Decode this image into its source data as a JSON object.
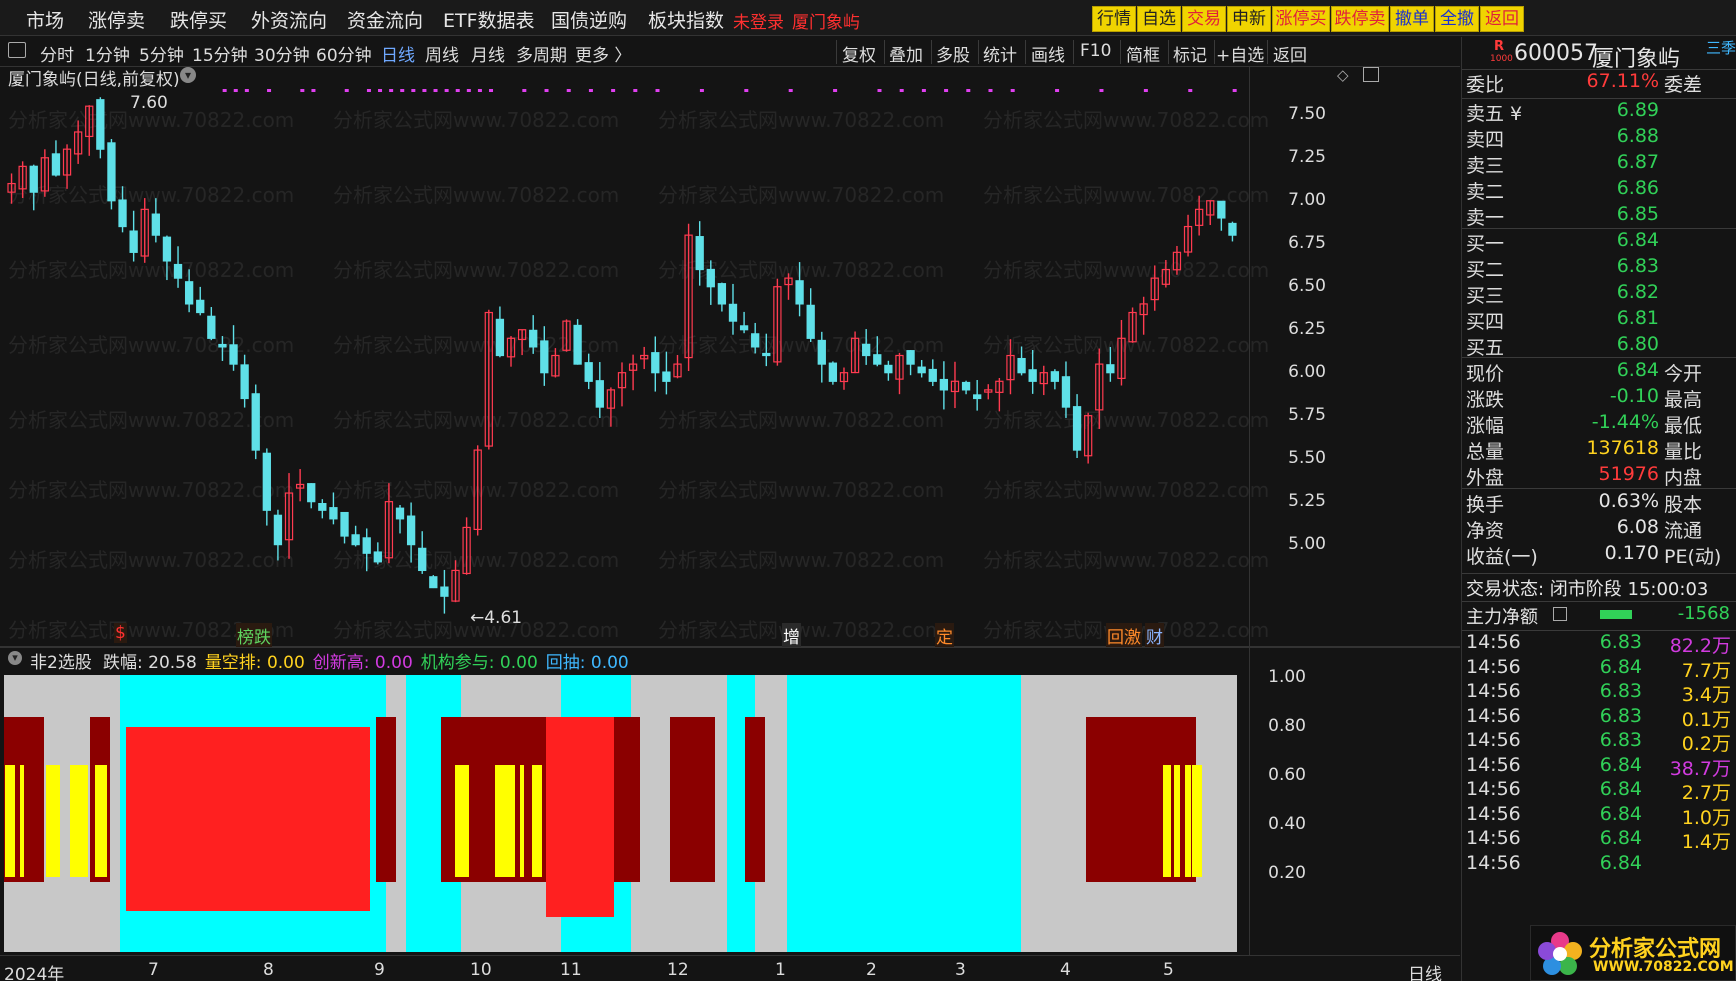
{
  "menu": {
    "items": [
      "市场",
      "涨停卖",
      "跌停买",
      "外资流向",
      "资金流向",
      "ETF数据表",
      "国债逆购",
      "板块指数"
    ],
    "not_logged_in": "未登录",
    "stock_tag": "厦门象屿",
    "buttons": [
      "行情",
      "自选",
      "交易",
      "申新",
      "涨停买",
      "跌停卖",
      "撤单",
      "全撤",
      "返回"
    ]
  },
  "toolbar": {
    "periods": [
      "分时",
      "1分钟",
      "5分钟",
      "15分钟",
      "30分钟",
      "60分钟",
      "日线",
      "周线",
      "月线",
      "多周期",
      "更多 〉"
    ],
    "active": "日线",
    "right_tools": [
      "复权",
      "叠加",
      "多股",
      "统计",
      "画线",
      "F10",
      "简框",
      "标记",
      "+自选",
      "返回"
    ]
  },
  "main_chart": {
    "title": "厦门象屿(日线,前复权)",
    "high_marker": "7.60",
    "low_marker": "←4.61",
    "y_ticks": [
      "7.50",
      "7.25",
      "7.00",
      "6.75",
      "6.50",
      "6.25",
      "6.00",
      "5.75",
      "5.50",
      "5.25",
      "5.00"
    ],
    "event_tags": [
      {
        "text": "$",
        "color": "#ff3030"
      },
      {
        "text": "榜跌",
        "color": "#5fd35f"
      },
      {
        "text": "增",
        "color": "#ffffff"
      },
      {
        "text": "定",
        "color": "#ff8a2a"
      },
      {
        "text": "回激",
        "color": "#ff8a2a"
      },
      {
        "text": "财",
        "color": "#8ab4ff"
      }
    ],
    "watermark": "分析家公式网www.70822.com"
  },
  "chart_data": {
    "type": "candlestick",
    "ylim": [
      4.55,
      7.65
    ],
    "high": 7.6,
    "low": 4.61,
    "close_series": [
      7.1,
      7.2,
      7.05,
      7.25,
      7.15,
      7.3,
      7.4,
      7.55,
      7.3,
      7.0,
      6.85,
      6.7,
      6.95,
      6.8,
      6.65,
      6.55,
      6.4,
      6.35,
      6.2,
      6.15,
      6.05,
      5.85,
      5.55,
      5.2,
      5.0,
      5.3,
      5.35,
      5.25,
      5.2,
      5.15,
      5.05,
      5.0,
      4.95,
      4.9,
      5.25,
      5.15,
      5.0,
      4.85,
      4.75,
      4.7,
      4.85,
      5.1,
      5.55,
      6.35,
      6.1,
      6.2,
      6.25,
      6.15,
      6.0,
      6.1,
      6.3,
      6.05,
      5.95,
      5.8,
      5.9,
      6.0,
      6.05,
      6.1,
      6.0,
      5.95,
      6.05,
      6.8,
      6.6,
      6.5,
      6.4,
      6.3,
      6.25,
      6.15,
      6.1,
      6.5,
      6.55,
      6.4,
      6.2,
      6.05,
      5.95,
      6.0,
      6.2,
      6.1,
      6.05,
      6.0,
      6.1,
      6.05,
      6.0,
      5.95,
      5.9,
      5.95,
      5.9,
      5.85,
      5.9,
      5.95,
      6.1,
      6.0,
      5.95,
      6.0,
      5.95,
      5.8,
      5.55,
      5.75,
      6.05,
      6.0,
      6.2,
      6.35,
      6.4,
      6.55,
      6.6,
      6.7,
      6.85,
      6.95,
      7.0,
      6.9,
      6.8
    ]
  },
  "indicator": {
    "name": "非2选股",
    "params": [
      {
        "label": "跌幅:",
        "value": "20.58",
        "color": "#e6e6e6"
      },
      {
        "label": "量空排:",
        "value": "0.00",
        "color": "#ffd21f"
      },
      {
        "label": "创新高:",
        "value": "0.00",
        "color": "#d23be0"
      },
      {
        "label": "机构参与:",
        "value": "0.00",
        "color": "#31d158"
      },
      {
        "label": "回抽:",
        "value": "0.00",
        "color": "#3fb8ff"
      }
    ],
    "y_ticks": [
      "1.00",
      "0.80",
      "0.60",
      "0.40",
      "0.20"
    ],
    "x_labels": [
      "2024年",
      "7",
      "8",
      "9",
      "10",
      "11",
      "12",
      "1",
      "2",
      "3",
      "4",
      "5"
    ],
    "period": "日线"
  },
  "quote": {
    "code": "600057",
    "name": "厦门象屿",
    "badge": "R",
    "badge_sub": "1000",
    "extra": "三季报",
    "weibi": {
      "label": "委比",
      "value": "67.11%",
      "label2": "委差"
    },
    "sells": [
      {
        "label": "卖五 ¥",
        "price": "6.89"
      },
      {
        "label": "卖四",
        "price": "6.88"
      },
      {
        "label": "卖三",
        "price": "6.87"
      },
      {
        "label": "卖二",
        "price": "6.86"
      },
      {
        "label": "卖一",
        "price": "6.85"
      }
    ],
    "buys": [
      {
        "label": "买一",
        "price": "6.84"
      },
      {
        "label": "买二",
        "price": "6.83"
      },
      {
        "label": "买三",
        "price": "6.82"
      },
      {
        "label": "买四",
        "price": "6.81"
      },
      {
        "label": "买五",
        "price": "6.80"
      }
    ],
    "stats": [
      {
        "label": "现价",
        "value": "6.84",
        "color": "#31d158",
        "label2": "今开"
      },
      {
        "label": "涨跌",
        "value": "-0.10",
        "color": "#31d158",
        "label2": "最高"
      },
      {
        "label": "涨幅",
        "value": "-1.44%",
        "color": "#31d158",
        "label2": "最低"
      },
      {
        "label": "总量",
        "value": "137618",
        "color": "#ffd21f",
        "label2": "量比"
      },
      {
        "label": "外盘",
        "value": "51976",
        "color": "#ff3b3b",
        "label2": "内盘"
      },
      {
        "label": "换手",
        "value": "0.63%",
        "color": "#e6e6e6",
        "label2": "股本"
      },
      {
        "label": "净资",
        "value": "6.08",
        "color": "#e6e6e6",
        "label2": "流通"
      },
      {
        "label": "收益(一)",
        "value": "0.170",
        "color": "#e6e6e6",
        "label2": "PE(动)"
      }
    ],
    "status": "交易状态: 闭市阶段 15:00:03",
    "net_flow_label": "主力净额",
    "net_flow_value": "-1568",
    "ticks": [
      {
        "time": "14:56",
        "price": "6.83",
        "vol": "82.2万",
        "vcolor": "#d23be0"
      },
      {
        "time": "14:56",
        "price": "6.84",
        "vol": "7.7万",
        "vcolor": "#ffd21f"
      },
      {
        "time": "14:56",
        "price": "6.83",
        "vol": "3.4万",
        "vcolor": "#ffd21f"
      },
      {
        "time": "14:56",
        "price": "6.83",
        "vol": "0.1万",
        "vcolor": "#ffd21f"
      },
      {
        "time": "14:56",
        "price": "6.83",
        "vol": "0.2万",
        "vcolor": "#ffd21f"
      },
      {
        "time": "14:56",
        "price": "6.84",
        "vol": "38.7万",
        "vcolor": "#d23be0"
      },
      {
        "time": "14:56",
        "price": "6.84",
        "vol": "2.7万",
        "vcolor": "#ffd21f"
      },
      {
        "time": "14:56",
        "price": "6.84",
        "vol": "1.0万",
        "vcolor": "#ffd21f"
      },
      {
        "time": "14:56",
        "price": "6.84",
        "vol": "1.4万",
        "vcolor": "#ffd21f"
      },
      {
        "time": "14:56",
        "price": "6.84",
        "vol": "",
        "vcolor": "#ffd21f"
      }
    ]
  },
  "logo": {
    "text": "分析家公式网",
    "url": "WWW.70822.COM"
  }
}
